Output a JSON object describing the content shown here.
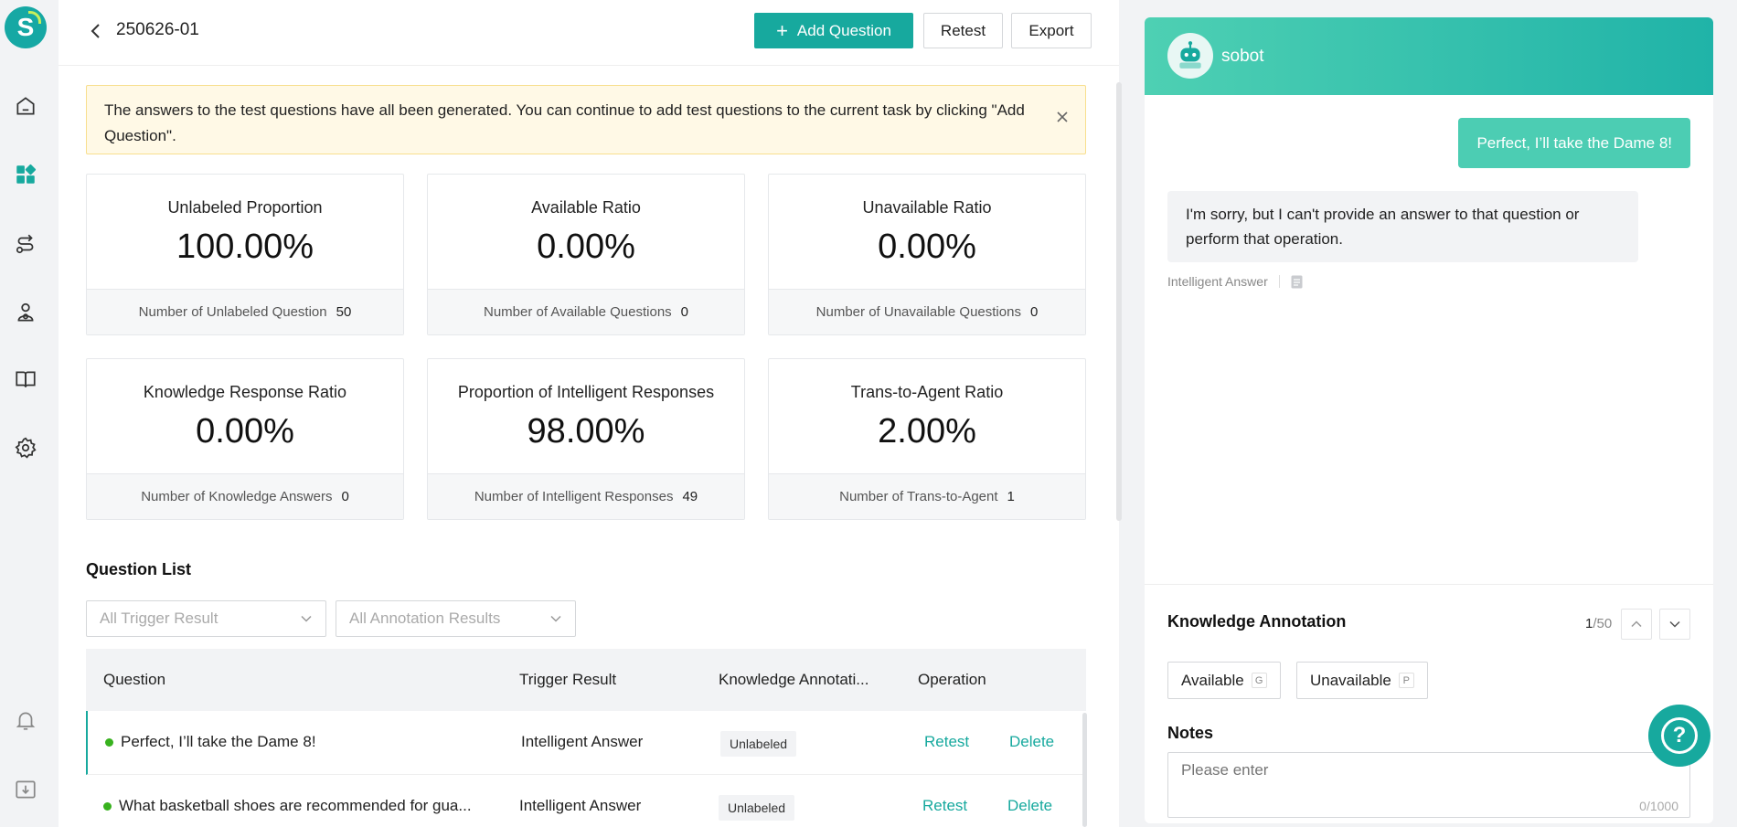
{
  "header": {
    "task_name": "250626-01",
    "add_question": "Add Question",
    "retest": "Retest",
    "export": "Export"
  },
  "notice": {
    "text": "The answers to the test questions have all been generated. You can continue to add test questions to the current task by clicking \"Add Question\"."
  },
  "stats": [
    {
      "title": "Unlabeled Proportion",
      "value": "100.00%",
      "foot_label": "Number of Unlabeled Question",
      "foot_value": "50"
    },
    {
      "title": "Available Ratio",
      "value": "0.00%",
      "foot_label": "Number of Available Questions",
      "foot_value": "0"
    },
    {
      "title": "Unavailable Ratio",
      "value": "0.00%",
      "foot_label": "Number of Unavailable Questions",
      "foot_value": "0"
    },
    {
      "title": "Knowledge Response Ratio",
      "value": "0.00%",
      "foot_label": "Number of Knowledge Answers",
      "foot_value": "0"
    },
    {
      "title": "Proportion of Intelligent Responses",
      "value": "98.00%",
      "foot_label": "Number of Intelligent Responses",
      "foot_value": "49"
    },
    {
      "title": "Trans-to-Agent Ratio",
      "value": "2.00%",
      "foot_label": "Number of Trans-to-Agent",
      "foot_value": "1"
    }
  ],
  "question_list": {
    "title": "Question List",
    "filter_trigger_placeholder": "All Trigger Result",
    "filter_annotation_placeholder": "All Annotation Results",
    "columns": [
      "Question",
      "Trigger Result",
      "Knowledge Annotati...",
      "Operation"
    ],
    "rows": [
      {
        "question": "Perfect, I’ll take the Dame 8!",
        "trigger": "Intelligent Answer",
        "annotation": "Unlabeled",
        "retest": "Retest",
        "delete": "Delete"
      },
      {
        "question": "What basketball shoes are recommended for gua...",
        "trigger": "Intelligent Answer",
        "annotation": "Unlabeled",
        "retest": "Retest",
        "delete": "Delete"
      }
    ]
  },
  "chat": {
    "bot_name": "sobot",
    "user_message": "Perfect, I’ll take the Dame 8!",
    "bot_message": "I'm sorry, but I can't provide an answer to that question or perform that operation.",
    "answer_type": "Intelligent Answer"
  },
  "annotation": {
    "title": "Knowledge Annotation",
    "current": "1",
    "total": "/50",
    "available": "Available",
    "available_key": "G",
    "unavailable": "Unavailable",
    "unavailable_key": "P",
    "notes_title": "Notes",
    "notes_placeholder": "Please enter",
    "notes_counter": "0/1000"
  },
  "colors": {
    "accent": "#17a99e",
    "notice_bg": "#fff9e6",
    "status_dot": "#38b21e"
  },
  "icons": {
    "rail": [
      "home-icon",
      "apps-icon",
      "route-icon",
      "bot-user-icon",
      "book-icon",
      "settings-icon",
      "bell-icon",
      "download-icon"
    ]
  }
}
